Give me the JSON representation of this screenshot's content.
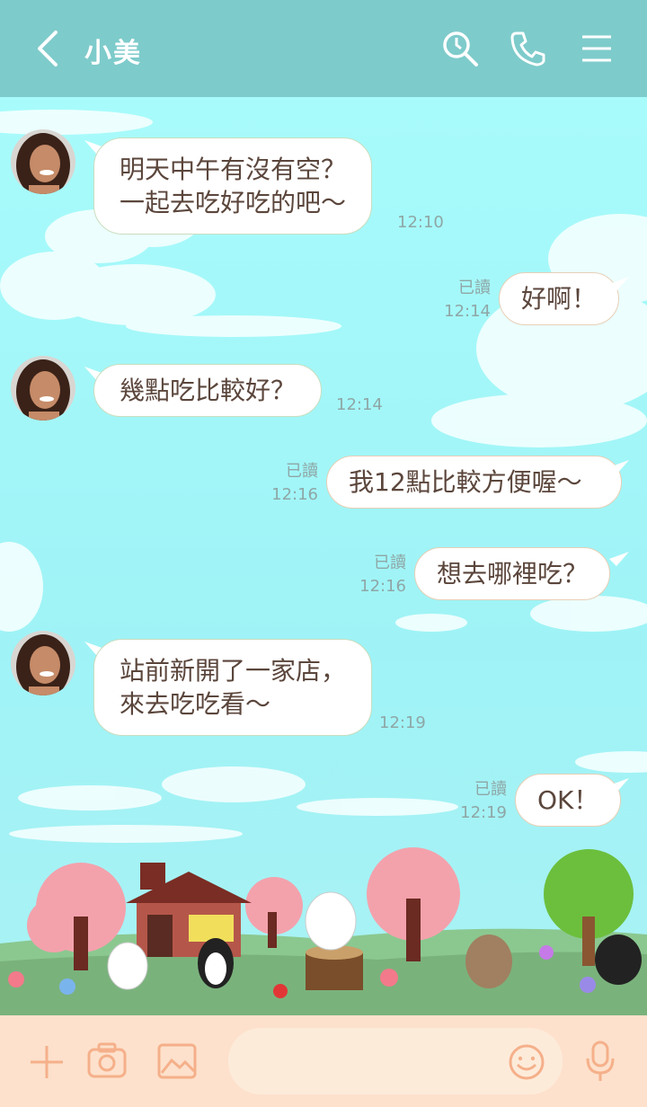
{
  "header": {
    "title": "小美"
  },
  "messages": [
    {
      "side": "left",
      "lines": [
        "明天中午有沒有空？",
        "一起去吃好吃的吧～"
      ],
      "time": "12:10"
    },
    {
      "side": "right",
      "text": "好啊！",
      "read": "已讀",
      "time": "12:14"
    },
    {
      "side": "left",
      "lines": [
        "幾點吃比較好？"
      ],
      "time": "12:14"
    },
    {
      "side": "right",
      "text": "我12點比較方便喔～",
      "read": "已讀",
      "time": "12:16"
    },
    {
      "side": "right",
      "text": "想去哪裡吃？",
      "read": "已讀",
      "time": "12:16"
    },
    {
      "side": "left",
      "lines": [
        "站前新開了一家店，",
        "來去吃吃看～"
      ],
      "time": "12:19"
    },
    {
      "side": "right",
      "text": "OK！",
      "read": "已讀",
      "time": "12:19"
    }
  ],
  "input": {
    "placeholder": ""
  },
  "colors": {
    "header": "#7ecbcb",
    "sky": "#a8fbfb",
    "footer": "#fde1cc",
    "icon": "#f5b08a",
    "text": "#5b463c"
  }
}
